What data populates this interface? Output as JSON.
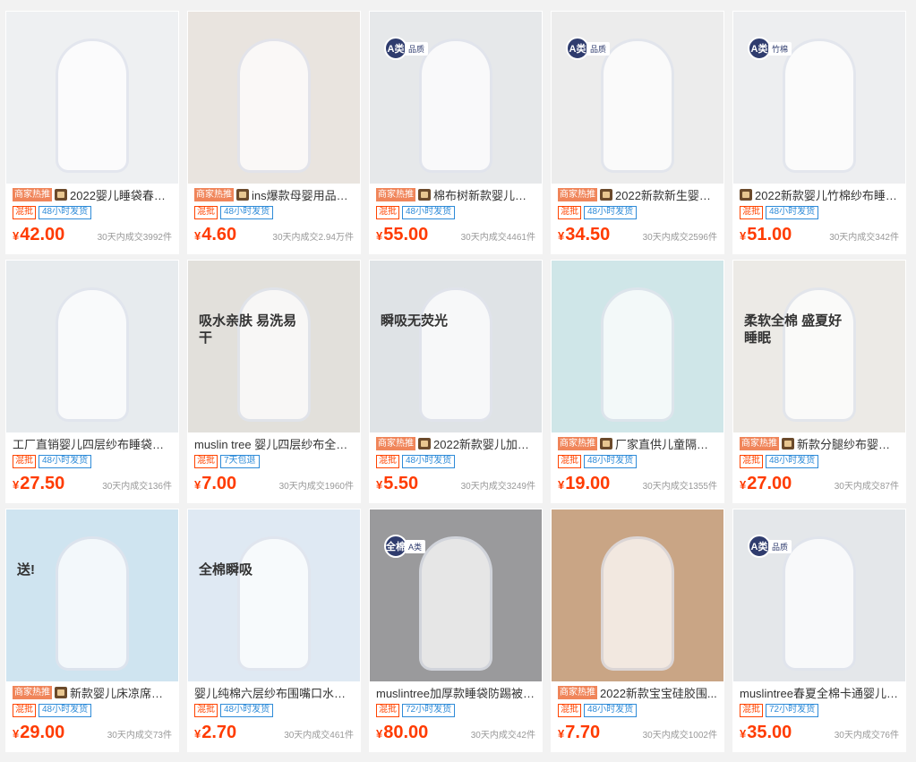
{
  "colors": {
    "accent_price": "#ff3b00",
    "hot_tag": "#f0855a",
    "ship_tag": "#2e8bd8"
  },
  "currency": "¥",
  "products": [
    {
      "hot": "商家热推",
      "shop": true,
      "title": "2022婴儿睡袋春秋...",
      "tag1": "混批",
      "tag2": "48小时发货",
      "price": "42.00",
      "sold": "30天内成交3992件",
      "bg": "#eef0f2",
      "badge": "",
      "badge_sub": "",
      "overlay": ""
    },
    {
      "hot": "商家热推",
      "shop": true,
      "title": "ins爆款母婴用品宝...",
      "tag1": "混批",
      "tag2": "48小时发货",
      "price": "4.60",
      "sold": "30天内成交2.94万件",
      "bg": "#e9e4df",
      "badge": "",
      "badge_sub": "",
      "overlay": ""
    },
    {
      "hot": "商家热推",
      "shop": true,
      "title": "棉布树新款婴儿睡...",
      "tag1": "混批",
      "tag2": "48小时发货",
      "price": "55.00",
      "sold": "30天内成交4461件",
      "bg": "#e6e8ea",
      "badge": "A类",
      "badge_sub": "品质",
      "overlay": ""
    },
    {
      "hot": "商家热推",
      "shop": true,
      "title": "2022新款新生婴儿...",
      "tag1": "混批",
      "tag2": "48小时发货",
      "price": "34.50",
      "sold": "30天内成交2596件",
      "bg": "#ececec",
      "badge": "A类",
      "badge_sub": "品质",
      "overlay": ""
    },
    {
      "hot": "",
      "shop": true,
      "title": "2022新款婴儿竹棉纱布睡袋...",
      "tag1": "混批",
      "tag2": "48小时发货",
      "price": "51.00",
      "sold": "30天内成交342件",
      "bg": "#edeef0",
      "badge": "A类",
      "badge_sub": "竹棉",
      "overlay": ""
    },
    {
      "hot": "",
      "shop": false,
      "title": "工厂直销婴儿四层纱布睡袋春秋...",
      "tag1": "混批",
      "tag2": "48小时发货",
      "price": "27.50",
      "sold": "30天内成交136件",
      "bg": "#e7ebee",
      "badge": "",
      "badge_sub": "",
      "overlay": ""
    },
    {
      "hot": "",
      "shop": false,
      "title": "muslin tree 婴儿四层纱布全棉...",
      "tag1": "混批",
      "tag2": "7天包退",
      "price": "7.00",
      "sold": "30天内成交1960件",
      "bg": "#e2e0db",
      "badge": "",
      "badge_sub": "",
      "overlay": "吸水亲肤 易洗易干"
    },
    {
      "hot": "商家热推",
      "shop": true,
      "title": "2022新款婴儿加大...",
      "tag1": "混批",
      "tag2": "48小时发货",
      "price": "5.50",
      "sold": "30天内成交3249件",
      "bg": "#dfe3e6",
      "badge": "",
      "badge_sub": "",
      "overlay": "瞬吸无荧光"
    },
    {
      "hot": "商家热推",
      "shop": true,
      "title": "厂家直供儿童隔尿...",
      "tag1": "混批",
      "tag2": "48小时发货",
      "price": "19.00",
      "sold": "30天内成交1355件",
      "bg": "#cfe6e8",
      "badge": "",
      "badge_sub": "",
      "overlay": ""
    },
    {
      "hot": "商家热推",
      "shop": true,
      "title": "新款分腿纱布婴儿...",
      "tag1": "混批",
      "tag2": "48小时发货",
      "price": "27.00",
      "sold": "30天内成交87件",
      "bg": "#eceae6",
      "badge": "",
      "badge_sub": "",
      "overlay": "柔软全棉 盛夏好睡眠"
    },
    {
      "hot": "商家热推",
      "shop": true,
      "title": "新款婴儿床凉席冰...",
      "tag1": "混批",
      "tag2": "48小时发货",
      "price": "29.00",
      "sold": "30天内成交73件",
      "bg": "#cfe4f0",
      "badge": "",
      "badge_sub": "",
      "overlay": "送!"
    },
    {
      "hot": "",
      "shop": false,
      "title": "婴儿纯棉六层纱布围嘴口水巾宝...",
      "tag1": "混批",
      "tag2": "48小时发货",
      "price": "2.70",
      "sold": "30天内成交461件",
      "bg": "#dfe9f3",
      "badge": "",
      "badge_sub": "",
      "overlay": "全棉瞬吸"
    },
    {
      "hot": "",
      "shop": false,
      "title": "muslintree加厚款睡袋防踢被纯...",
      "tag1": "混批",
      "tag2": "72小时发货",
      "price": "80.00",
      "sold": "30天内成交42件",
      "bg": "#9a9a9c",
      "badge": "全棉",
      "badge_sub": "A类",
      "overlay": ""
    },
    {
      "hot": "商家热推",
      "shop": false,
      "title": "2022新款宝宝硅胶围...",
      "tag1": "混批",
      "tag2": "48小时发货",
      "price": "7.70",
      "sold": "30天内成交1002件",
      "bg": "#c9a585",
      "badge": "",
      "badge_sub": "",
      "overlay": ""
    },
    {
      "hot": "",
      "shop": false,
      "title": "muslintree春夏全棉卡通婴儿盖...",
      "tag1": "混批",
      "tag2": "72小时发货",
      "price": "35.00",
      "sold": "30天内成交76件",
      "bg": "#e4e7ea",
      "badge": "A类",
      "badge_sub": "品质",
      "overlay": ""
    }
  ]
}
